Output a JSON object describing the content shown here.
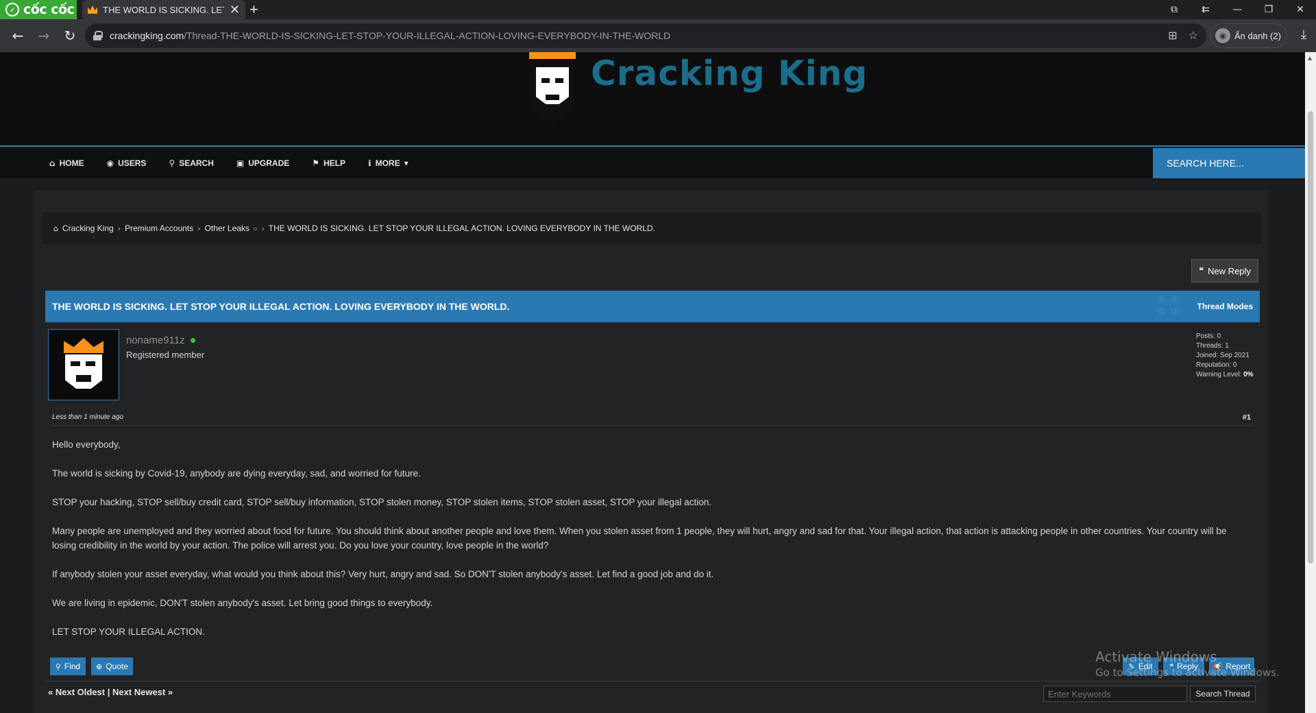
{
  "browser": {
    "brand": "cốc cốc",
    "tab_title": "THE WORLD IS SICKING. LET",
    "url_host": "crackingking.com",
    "url_path": "/Thread-THE-WORLD-IS-SICKING-LET-STOP-YOUR-ILLEGAL-ACTION-LOVING-EVERYBODY-IN-THE-WORLD",
    "profile_label": "Ẩn danh (2)"
  },
  "site": {
    "logo_text": "Cracking King",
    "nav": [
      {
        "label": "HOME",
        "icon": "home-icon"
      },
      {
        "label": "USERS",
        "icon": "user-circle-icon"
      },
      {
        "label": "SEARCH",
        "icon": "search-icon"
      },
      {
        "label": "UPGRADE",
        "icon": "money-icon"
      },
      {
        "label": "HELP",
        "icon": "flag-icon"
      },
      {
        "label": "MORE",
        "icon": "info-icon"
      }
    ],
    "search_placeholder": "SEARCH HERE..."
  },
  "breadcrumb": [
    "Cracking King",
    "Premium Accounts",
    "Other Leaks",
    "THE WORLD IS SICKING. LET STOP YOUR ILLEGAL ACTION. LOVING EVERYBODY IN THE WORLD."
  ],
  "thread": {
    "new_reply": "New Reply",
    "title": "THE WORLD IS SICKING. LET STOP YOUR ILLEGAL ACTION. LOVING EVERYBODY IN THE WORLD.",
    "modes": "Thread Modes"
  },
  "post": {
    "username": "noname911z",
    "usertitle": "Registered member",
    "stats": {
      "posts": "Posts: 0",
      "threads": "Threads: 1",
      "joined": "Joined: Sep 2021",
      "reputation": "Reputation: 0",
      "warning_label": "Warning Level:",
      "warning_value": "0%"
    },
    "date": "Less than 1 minute ago",
    "number": "#1",
    "paragraphs": [
      "Hello everybody,",
      "The world is sicking by Covid-19, anybody are dying everyday, sad, and worried for future.",
      "STOP your hacking, STOP sell/buy credit card, STOP sell/buy information, STOP stolen money, STOP stolen items, STOP stolen asset, STOP your illegal action.",
      "Many people are unemployed and they worried about food for future. You should think about another people and love them. When you stolen asset from 1 people, they will hurt, angry and sad for that. Your illegal action, that action is attacking people in other countries. Your country will be losing credibility in the world by your action. The police will arrest you. Do you love your country, love people in the world?",
      "If anybody stolen your asset everyday, what would you think about this? Very hurt, angry and sad. So DON'T stolen anybody's asset. Let find a good job and do it.",
      "We are living in epidemic, DON'T stolen anybody's asset. Let bring good things to everybody.",
      "LET STOP YOUR ILLEGAL ACTION."
    ],
    "buttons": {
      "find": "Find",
      "quote": "Quote",
      "edit": "Edit",
      "reply": "Reply",
      "report": "Report"
    }
  },
  "footer": {
    "next_links": "« Next Oldest | Next Newest »",
    "keywords_placeholder": "Enter Keywords",
    "search_thread": "Search Thread"
  },
  "watermark": {
    "title": "Activate Windows",
    "subtitle": "Go to Settings to activate Windows."
  }
}
